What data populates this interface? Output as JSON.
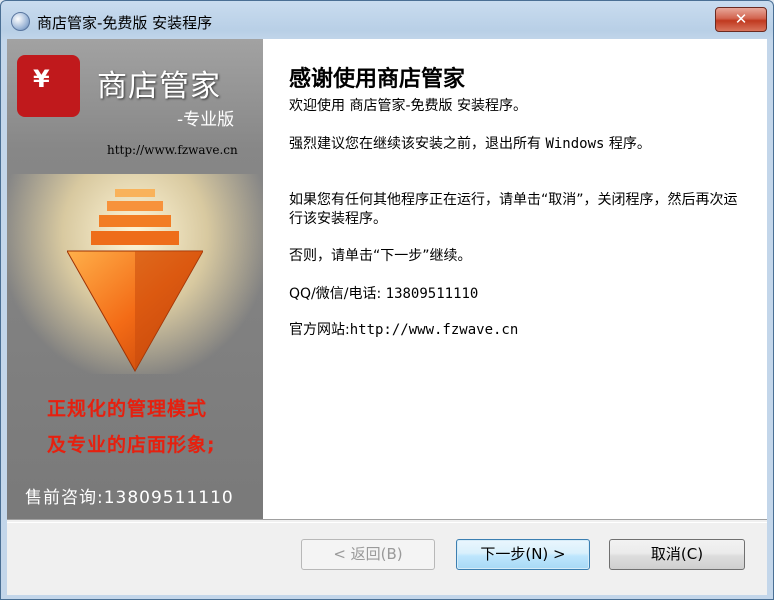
{
  "window": {
    "title": "商店管家-免费版 安装程序"
  },
  "titlebar": {
    "close_glyph": "✕"
  },
  "sidebar": {
    "logo_glyph": "¥",
    "brand_name": "商店管家",
    "brand_sub": "-专业版",
    "url": "http://www.fzwave.cn",
    "slogan_line1": "正规化的管理模式",
    "slogan_line2": "及专业的店面形象;",
    "hotline": "售前咨询:13809511110"
  },
  "content": {
    "heading": "感谢使用商店管家",
    "welcome": "欢迎使用 商店管家-免费版 安装程序。",
    "advice_pre": "强烈建议您在继续该安装之前，退出所有 ",
    "advice_mono": "Windows",
    "advice_post": " 程序。",
    "running": "如果您有任何其他程序正在运行，请单击“取消”，关闭程序，然后再次运行该安装程序。",
    "otherwise": "否则，请单击“下一步”继续。",
    "contact_label": "QQ/微信/电话: ",
    "contact_value": "13809511110",
    "website_label": "官方网站:",
    "website_value": "http://www.fzwave.cn"
  },
  "buttons": {
    "back": "< 返回(B)",
    "next": "下一步(N) >",
    "cancel": "取消(C)"
  },
  "colors": {
    "accent_red": "#e6200f",
    "logo_red": "#c0191c",
    "arrow_orange": "#f36b16"
  }
}
